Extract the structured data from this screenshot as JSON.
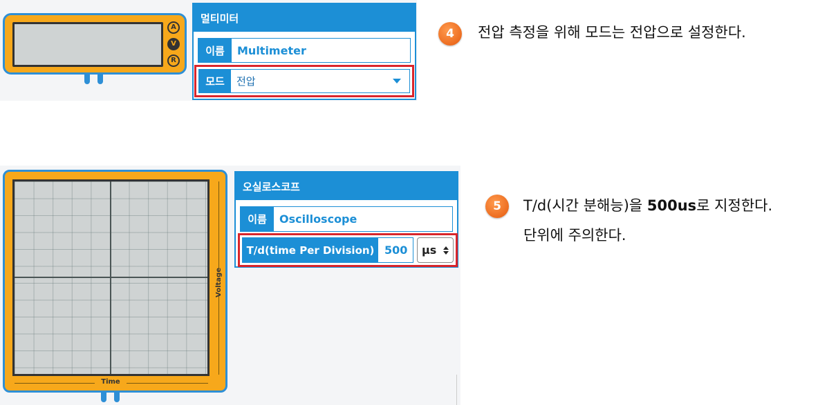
{
  "multimeter": {
    "buttons": [
      "A",
      "V",
      "R"
    ],
    "active_button": "V",
    "panel": {
      "title": "멀티미터",
      "name_label": "이름",
      "name_value": "Multimeter",
      "mode_label": "모드",
      "mode_value": "전압"
    }
  },
  "oscilloscope": {
    "axis_y_label": "Voltage",
    "axis_x_label": "Time",
    "panel": {
      "title": "오실로스코프",
      "name_label": "이름",
      "name_value": "Oscilloscope",
      "td_label": "T/d(time Per Division)",
      "td_value": "500",
      "td_unit": "μs"
    }
  },
  "steps": [
    {
      "number": "4",
      "text": "전압 측정을 위해 모드는 전압으로 설정한다."
    },
    {
      "number": "5",
      "line1_pre": "T/d(시간 분해능)을 ",
      "line1_bold": "500us",
      "line1_post": "로 지정한다.",
      "line2": "단위에 주의한다."
    }
  ],
  "colors": {
    "accent": "#1c8fd6",
    "device": "#f7a81b",
    "highlight": "#d9252b",
    "step_badge": "#f07022"
  }
}
